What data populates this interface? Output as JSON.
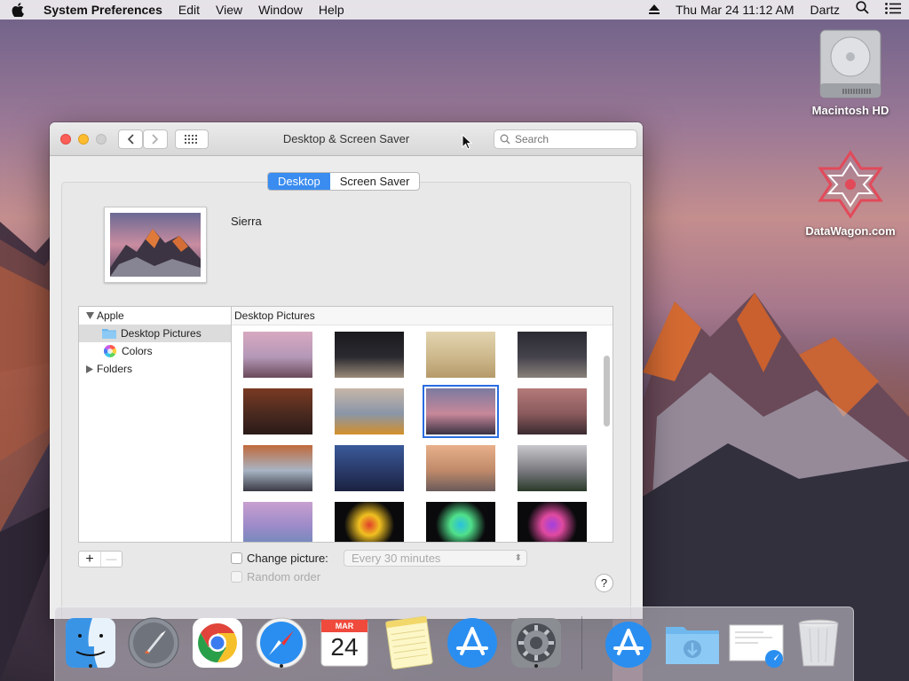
{
  "menubar": {
    "app_name": "System Preferences",
    "items": [
      "Edit",
      "View",
      "Window",
      "Help"
    ],
    "datetime": "Thu Mar 24  11:12 AM",
    "user": "Dartz"
  },
  "desktop_icons": [
    {
      "label": "Macintosh HD",
      "icon": "hard-drive-icon"
    },
    {
      "label": "DataWagon.com",
      "icon": "datawagon-logo-icon"
    }
  ],
  "window": {
    "title": "Desktop & Screen Saver",
    "search_placeholder": "Search",
    "tabs": [
      "Desktop",
      "Screen Saver"
    ],
    "active_tab": "Desktop",
    "current_picture_name": "Sierra",
    "source_list": {
      "group_apple": "Apple",
      "item_desktop_pictures": "Desktop Pictures",
      "item_colors": "Colors",
      "group_folders": "Folders"
    },
    "grid_header": "Desktop Pictures",
    "change_picture_label": "Change picture:",
    "interval_value": "Every 30 minutes",
    "random_order_label": "Random order",
    "add_label": "+",
    "remove_label": "—",
    "help_label": "?"
  },
  "dock": {
    "apps": [
      "finder",
      "launchpad",
      "chrome",
      "safari",
      "calendar",
      "notes",
      "app-store",
      "system-preferences"
    ],
    "calendar_month": "MAR",
    "calendar_day": "24",
    "running": [
      "finder",
      "safari",
      "system-preferences"
    ]
  },
  "colors": {
    "accent": "#3a8cf0",
    "selection": "#2a6de0"
  }
}
